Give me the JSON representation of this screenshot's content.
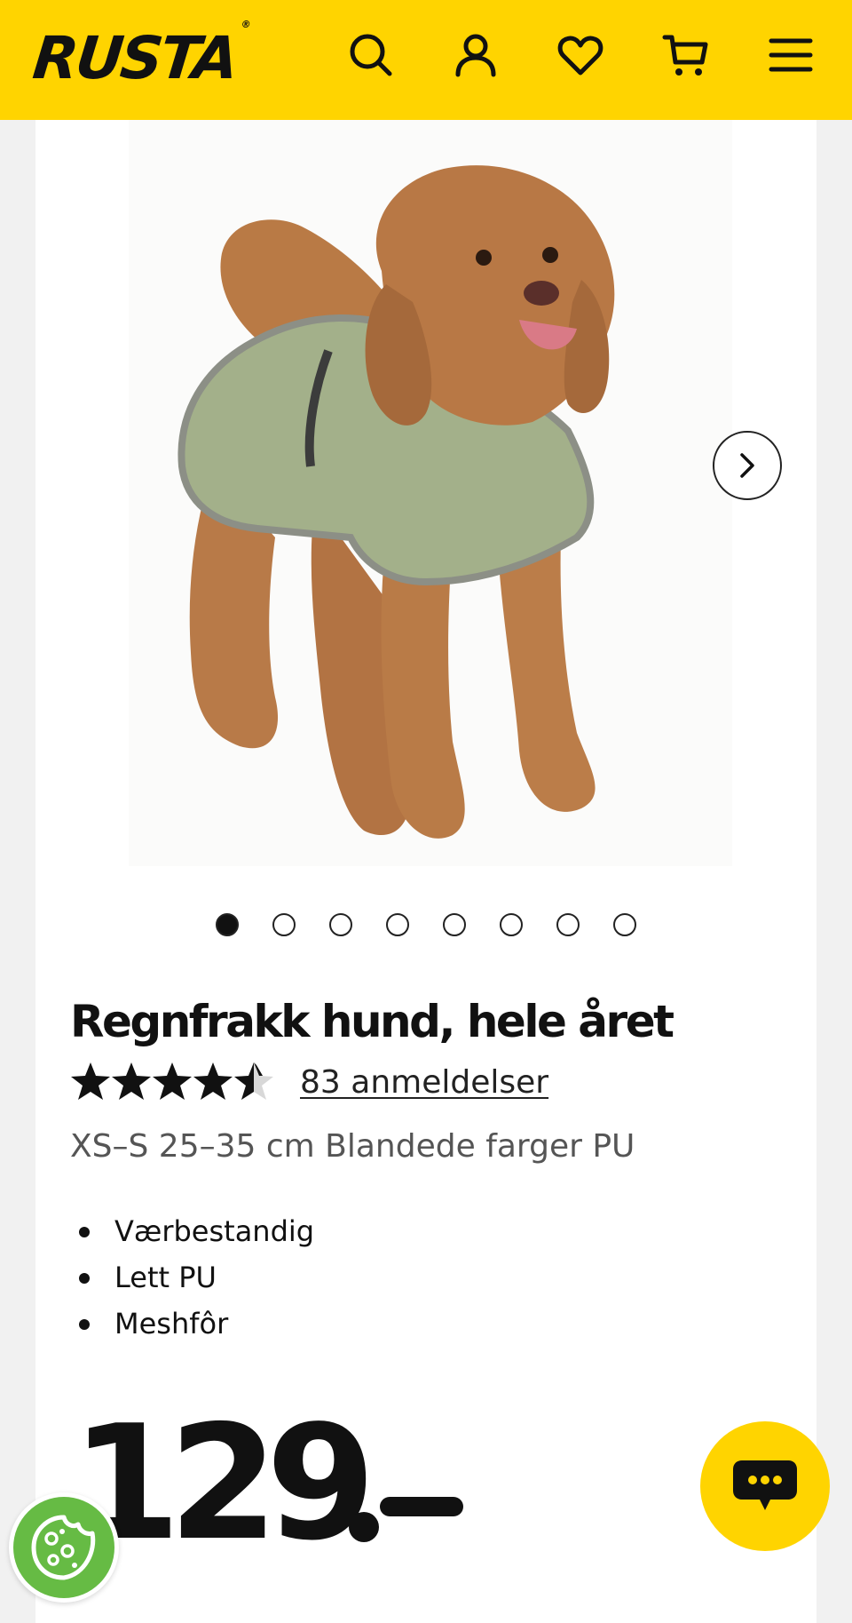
{
  "header": {
    "logo_text": "RUSTA",
    "logo_mark": "®",
    "background": "#ffd400",
    "icons": [
      "search-icon",
      "account-icon",
      "heart-icon",
      "cart-icon",
      "menu-icon"
    ]
  },
  "gallery": {
    "image_alt": "Dog wearing green rain coat",
    "slide_count": 8,
    "active_slide": 1,
    "next_icon": "chevron-right-icon"
  },
  "product": {
    "title": "Regnfrakk hund, hele året",
    "rating": 4.5,
    "rating_max": 5,
    "reviews_label": "83 anmeldelser",
    "variant": "XS–S 25–35 cm Blandede farger PU",
    "features": [
      "Værbestandig",
      "Lett PU",
      "Meshfôr"
    ],
    "price": "129",
    "price_suffix": "-"
  },
  "floating": {
    "chat_icon": "chat-bubble-icon",
    "cookie_icon": "cookie-icon",
    "chat_color": "#ffd400",
    "cookie_color": "#66bb44"
  }
}
